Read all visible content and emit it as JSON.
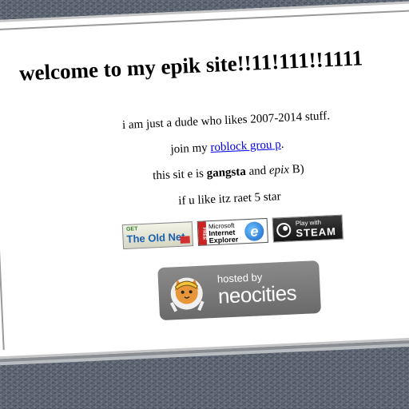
{
  "heading": "welcome to my epik site!!11!111!!1111",
  "intro": "i am just a dude who likes 2007-2014 stuff.",
  "join": {
    "before": "join my ",
    "link": "roblock grou p",
    "after": "."
  },
  "gangsta": {
    "a": "this sit e is ",
    "bold": "gangsta",
    "b": " and ",
    "italic": "epix",
    "c": " B)"
  },
  "rating": "if u like itz raet 5 star",
  "badges": {
    "oldnet": {
      "get": "GET",
      "name": "The Old Net"
    },
    "ie": {
      "free": "FREE",
      "l1": "Microsoft",
      "l2": "Internet",
      "l3": "Explorer",
      "glyph": "e"
    },
    "steam": {
      "play": "Play with",
      "name": "STEAM"
    }
  },
  "neocities": {
    "hosted": "hosted by",
    "name": "neocities"
  },
  "colors": {
    "background": "#5d6472",
    "link": "#0000ee",
    "neocities_badge": "#7a7a7a"
  }
}
